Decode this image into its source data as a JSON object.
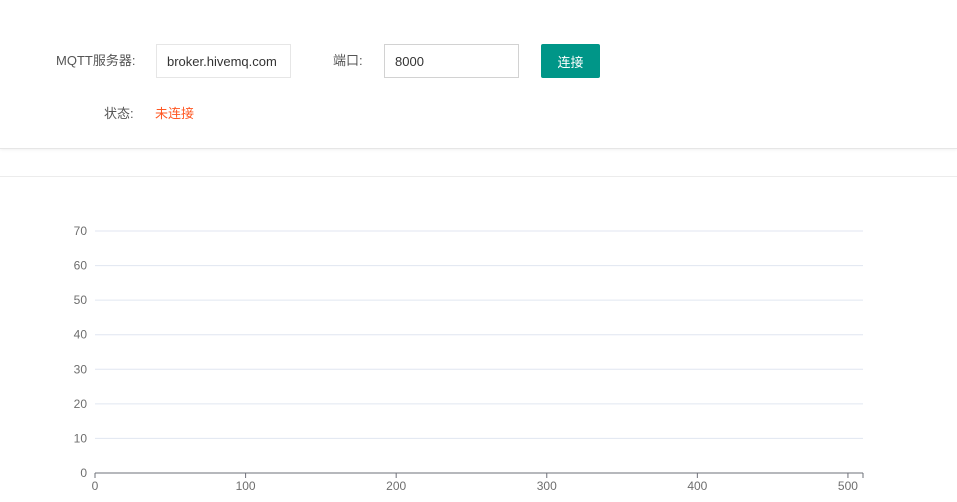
{
  "form": {
    "server_label": "MQTT服务器:",
    "server_value": "broker.hivemq.com",
    "port_label": "端口:",
    "port_value": "8000",
    "connect_button": "连接",
    "status_label": "状态:",
    "status_value": "未连接"
  },
  "colors": {
    "accent": "#009688",
    "status_disconnected": "#ff5722",
    "gridline": "#e0e6f1",
    "axis": "#6e7079"
  },
  "chart_data": {
    "type": "line",
    "title": "",
    "xlabel": "",
    "ylabel": "",
    "xlim": [
      0,
      510
    ],
    "ylim": [
      0,
      70
    ],
    "x_ticks": [
      0,
      100,
      200,
      300,
      400,
      500
    ],
    "y_ticks": [
      0,
      10,
      20,
      30,
      40,
      50,
      60,
      70
    ],
    "series": [
      {
        "values": []
      }
    ],
    "grid": true
  }
}
